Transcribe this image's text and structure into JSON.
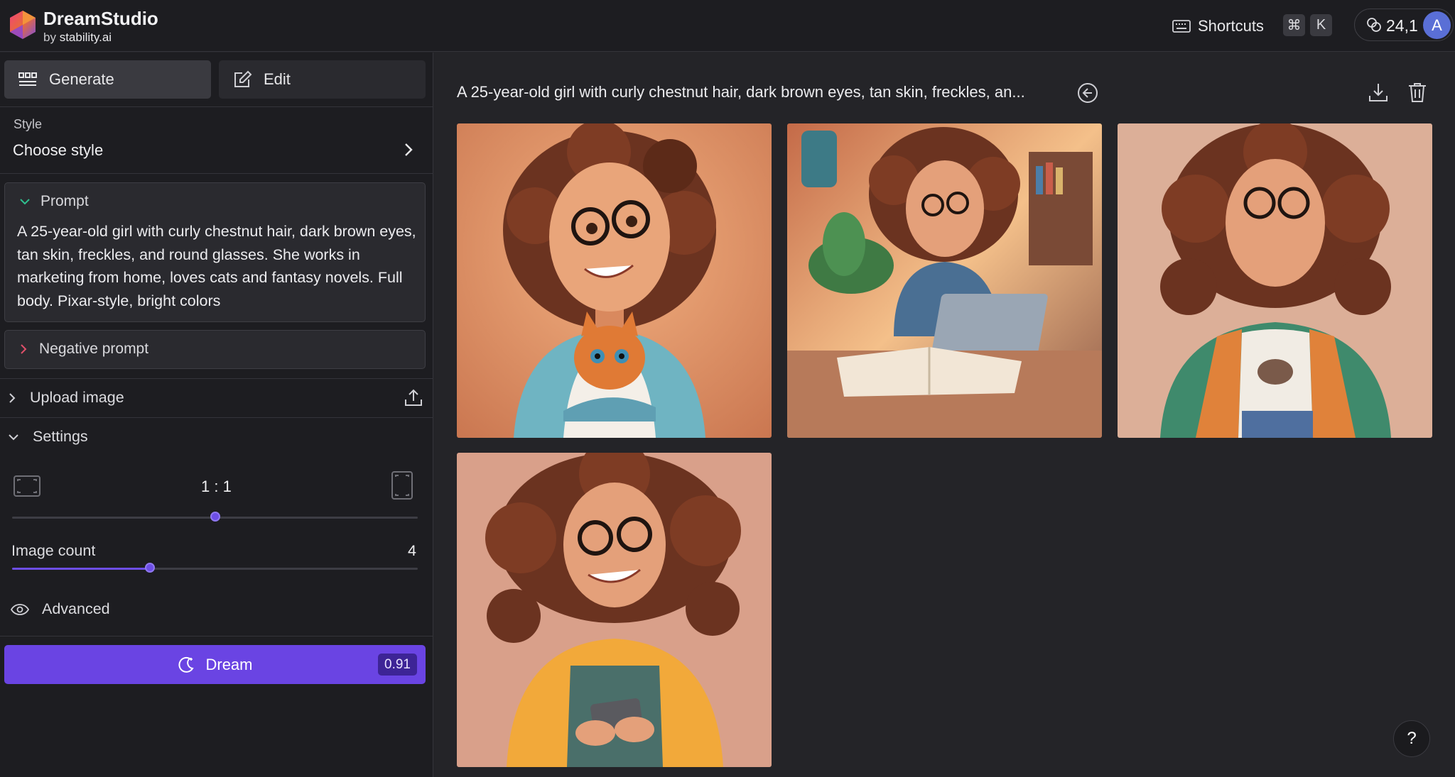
{
  "app": {
    "title": "DreamStudio",
    "by_prefix": "by",
    "by_name": "stability.ai"
  },
  "topbar": {
    "shortcuts_label": "Shortcuts",
    "shortcut_keys": [
      "⌘",
      "K"
    ],
    "credits": "24,1",
    "avatar_initial": "A"
  },
  "sidebar": {
    "tabs": [
      {
        "label": "Generate",
        "icon": "grid-icon",
        "active": true
      },
      {
        "label": "Edit",
        "icon": "edit-icon",
        "active": false
      }
    ],
    "style": {
      "label": "Style",
      "value": "Choose style"
    },
    "prompt": {
      "label": "Prompt",
      "text": "A 25-year-old girl with curly chestnut hair, dark brown eyes, tan skin, freckles, and round glasses. She works in marketing from home, loves cats and fantasy novels. Full body. Pixar-style, bright colors"
    },
    "negative_prompt": {
      "label": "Negative prompt"
    },
    "upload_image": {
      "label": "Upload image"
    },
    "settings": {
      "label": "Settings",
      "aspect_ratio": {
        "value": "1 : 1",
        "slider_fraction": 0.5
      },
      "image_count": {
        "label": "Image count",
        "value": "4",
        "slider_fraction": 0.34
      },
      "advanced_label": "Advanced"
    },
    "dream_button": {
      "label": "Dream",
      "cost": "0.91"
    }
  },
  "main": {
    "title": "A 25-year-old girl with curly chestnut hair, dark brown eyes, tan skin, freckles, an...",
    "images": [
      {
        "name": "generated-image-1",
        "scene": "girl-holding-cat"
      },
      {
        "name": "generated-image-2",
        "scene": "girl-at-desk"
      },
      {
        "name": "generated-image-3",
        "scene": "girl-in-sweater"
      },
      {
        "name": "generated-image-4",
        "scene": "girl-with-phone"
      }
    ],
    "help_label": "?"
  },
  "colors": {
    "accent": "#6a44e3",
    "background": "#242428",
    "panel": "#1d1d21"
  }
}
